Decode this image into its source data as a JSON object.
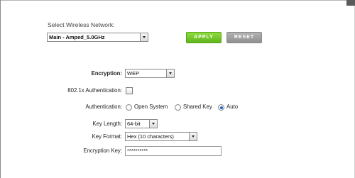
{
  "network": {
    "label": "Select Wireless Network:",
    "selected": "Main - Amped_5.0GHz"
  },
  "buttons": {
    "apply": "APPLY",
    "reset": "RESET"
  },
  "colors": {
    "apply": "#6cc225",
    "reset": "#9e9e9e",
    "radio_selected": "#1e62c9"
  },
  "encryption": {
    "label": "Encryption:",
    "value": "WEP"
  },
  "auth8021x": {
    "label": "802.1x Authentication:",
    "checked": false
  },
  "authentication": {
    "label": "Authentication:",
    "options": [
      "Open System",
      "Shared Key",
      "Auto"
    ],
    "selected": "Auto"
  },
  "key_length": {
    "label": "Key Length:",
    "value": "64-bit"
  },
  "key_format": {
    "label": "Key Format:",
    "value": "Hex (10 characters)"
  },
  "encryption_key": {
    "label": "Encryption Key:",
    "value": "**********"
  }
}
